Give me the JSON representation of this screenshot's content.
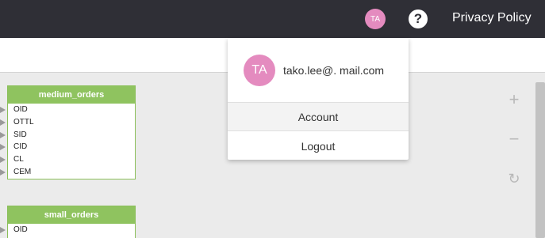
{
  "header": {
    "avatar_initials": "TA",
    "help_icon_glyph": "?",
    "privacy_label": "Privacy Policy"
  },
  "user_menu": {
    "avatar_initials": "TA",
    "email": "tako.lee@.  mail.com",
    "items": [
      {
        "label": "Account"
      },
      {
        "label": "Logout"
      }
    ]
  },
  "tables": [
    {
      "name": "medium_orders",
      "columns": [
        "OID",
        "OTTL",
        "SID",
        "CID",
        "CL",
        "CEM"
      ]
    },
    {
      "name": "small_orders",
      "columns": [
        "OID"
      ]
    }
  ],
  "controls": {
    "zoom_in_glyph": "+",
    "zoom_out_glyph": "−",
    "reset_glyph": "↻"
  },
  "colors": {
    "topbar": "#2f2f36",
    "avatar": "#e48bbf",
    "table_header": "#8fc35f"
  }
}
